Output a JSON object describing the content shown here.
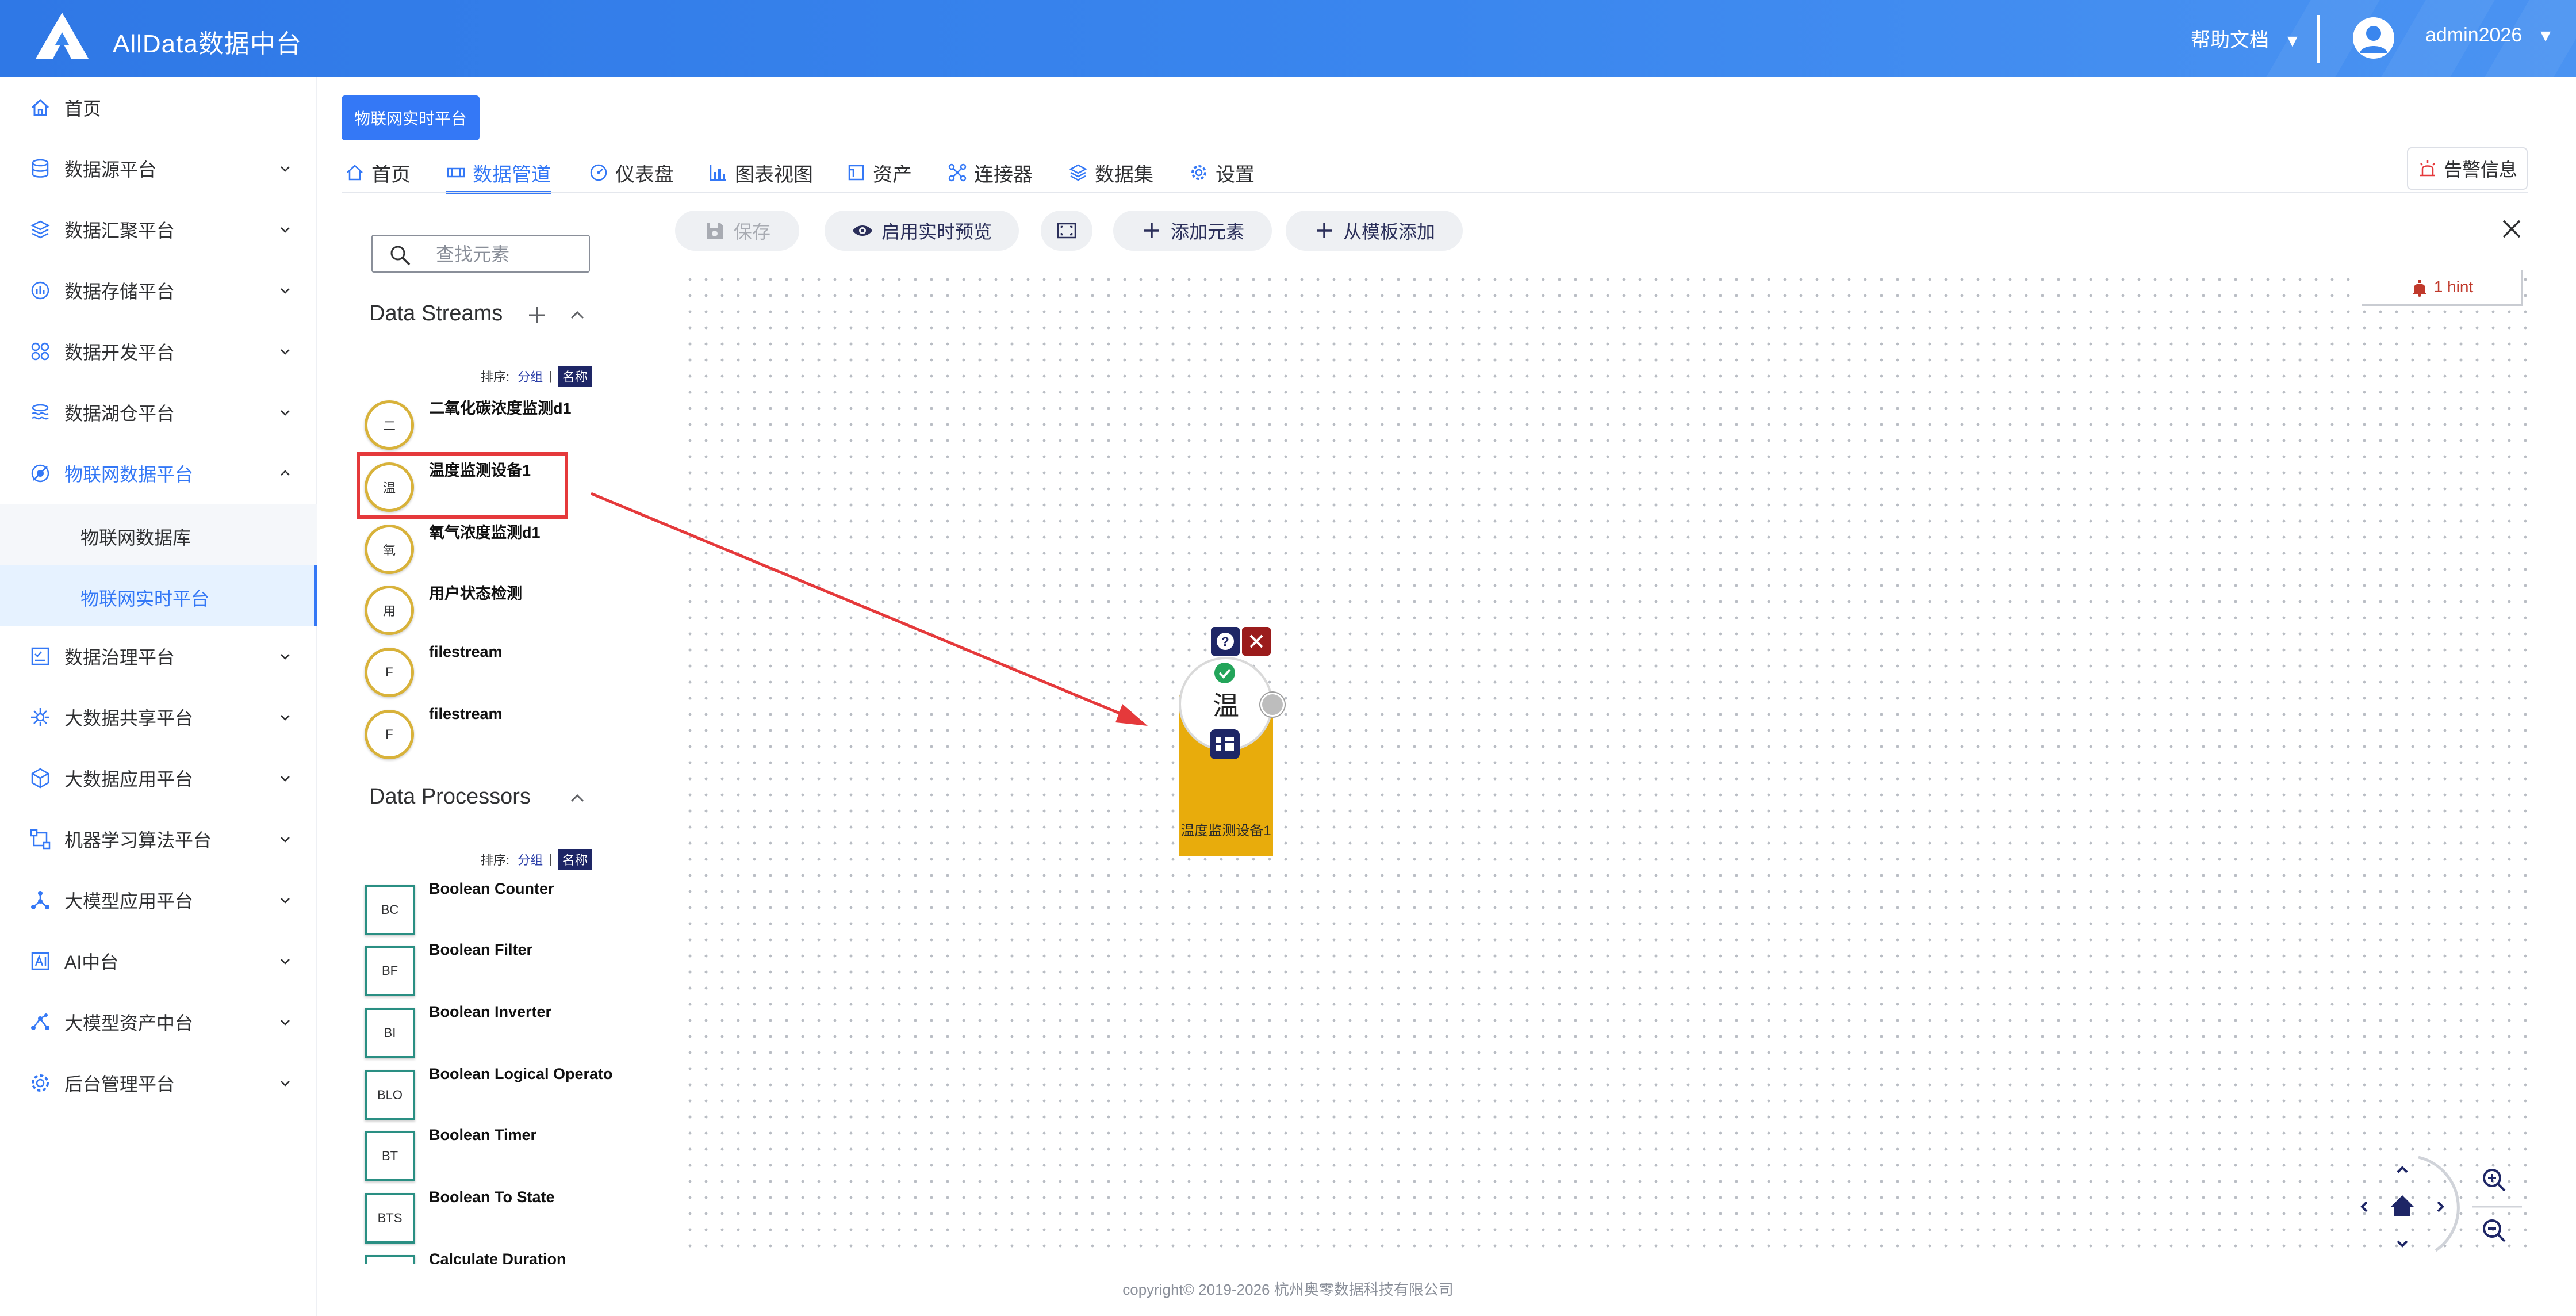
{
  "header": {
    "app_title": "AllData数据中台",
    "help_label": "帮助文档",
    "user_name": "admin2026",
    "caret": "▼"
  },
  "sidebar": {
    "items": [
      {
        "label": "首页",
        "icon": "home-icon"
      },
      {
        "label": "数据源平台",
        "icon": "database-icon"
      },
      {
        "label": "数据汇聚平台",
        "icon": "layers-icon"
      },
      {
        "label": "数据存储平台",
        "icon": "chart-icon"
      },
      {
        "label": "数据开发平台",
        "icon": "grid-icon"
      },
      {
        "label": "数据湖仓平台",
        "icon": "lake-icon"
      },
      {
        "label": "物联网数据平台",
        "icon": "iot-icon",
        "active": true
      },
      {
        "label": "数据治理平台",
        "icon": "checklist-icon"
      },
      {
        "label": "大数据共享平台",
        "icon": "share-icon"
      },
      {
        "label": "大数据应用平台",
        "icon": "cube-icon"
      },
      {
        "label": "机器学习算法平台",
        "icon": "flow-icon"
      },
      {
        "label": "大模型应用平台",
        "icon": "network-icon"
      },
      {
        "label": "AI中台",
        "icon": "ai-icon"
      },
      {
        "label": "大模型资产中台",
        "icon": "nodes-icon"
      },
      {
        "label": "后台管理平台",
        "icon": "settings-icon"
      }
    ],
    "subitems": [
      {
        "label": "物联网数据库"
      },
      {
        "label": "物联网实时平台",
        "selected": true
      }
    ]
  },
  "page_tag": "物联网实时平台",
  "tabs": [
    {
      "label": "首页"
    },
    {
      "label": "数据管道",
      "active": true
    },
    {
      "label": "仪表盘"
    },
    {
      "label": "图表视图"
    },
    {
      "label": "资产"
    },
    {
      "label": "连接器"
    },
    {
      "label": "数据集"
    },
    {
      "label": "设置"
    }
  ],
  "alarm_label": "告警信息",
  "toolbar": {
    "save": "保存",
    "live_preview": "启用实时预览",
    "add_element": "添加元素",
    "add_from_template": "从模板添加"
  },
  "search": {
    "placeholder": "查找元素",
    "value": ""
  },
  "streams": {
    "title": "Data Streams",
    "sort_label": "排序:",
    "sort_group": "分组",
    "sort_name": "名称",
    "items": [
      {
        "abbr": "二",
        "name": "二氧化碳浓度监测d1"
      },
      {
        "abbr": "温",
        "name": "温度监测设备1"
      },
      {
        "abbr": "氧",
        "name": "氧气浓度监测d1"
      },
      {
        "abbr": "用",
        "name": "用户状态检测"
      },
      {
        "abbr": "F",
        "name": "filestream"
      },
      {
        "abbr": "F",
        "name": "filestream"
      }
    ]
  },
  "processors": {
    "title": "Data Processors",
    "sort_label": "排序:",
    "sort_group": "分组",
    "sort_name": "名称",
    "items": [
      {
        "abbr": "BC",
        "name": "Boolean Counter"
      },
      {
        "abbr": "BF",
        "name": "Boolean Filter"
      },
      {
        "abbr": "BI",
        "name": "Boolean Inverter"
      },
      {
        "abbr": "BLO",
        "name": "Boolean Logical Operato"
      },
      {
        "abbr": "BT",
        "name": "Boolean Timer"
      },
      {
        "abbr": "BTS",
        "name": "Boolean To State"
      },
      {
        "abbr": "",
        "name": "Calculate Duration"
      }
    ]
  },
  "hint": {
    "text": "1 hint"
  },
  "canvas_node": {
    "abbr": "温",
    "name": "温度监测设备1"
  },
  "footer": {
    "copyright": "copyright© 2019-2026 杭州奥零数据科技有限公司"
  },
  "colors": {
    "primary": "#3478f6",
    "stream_border": "#d8b23a",
    "processor_border": "#2a8f83",
    "node_fill": "#e8ac0c",
    "highlight": "#e5393b"
  }
}
